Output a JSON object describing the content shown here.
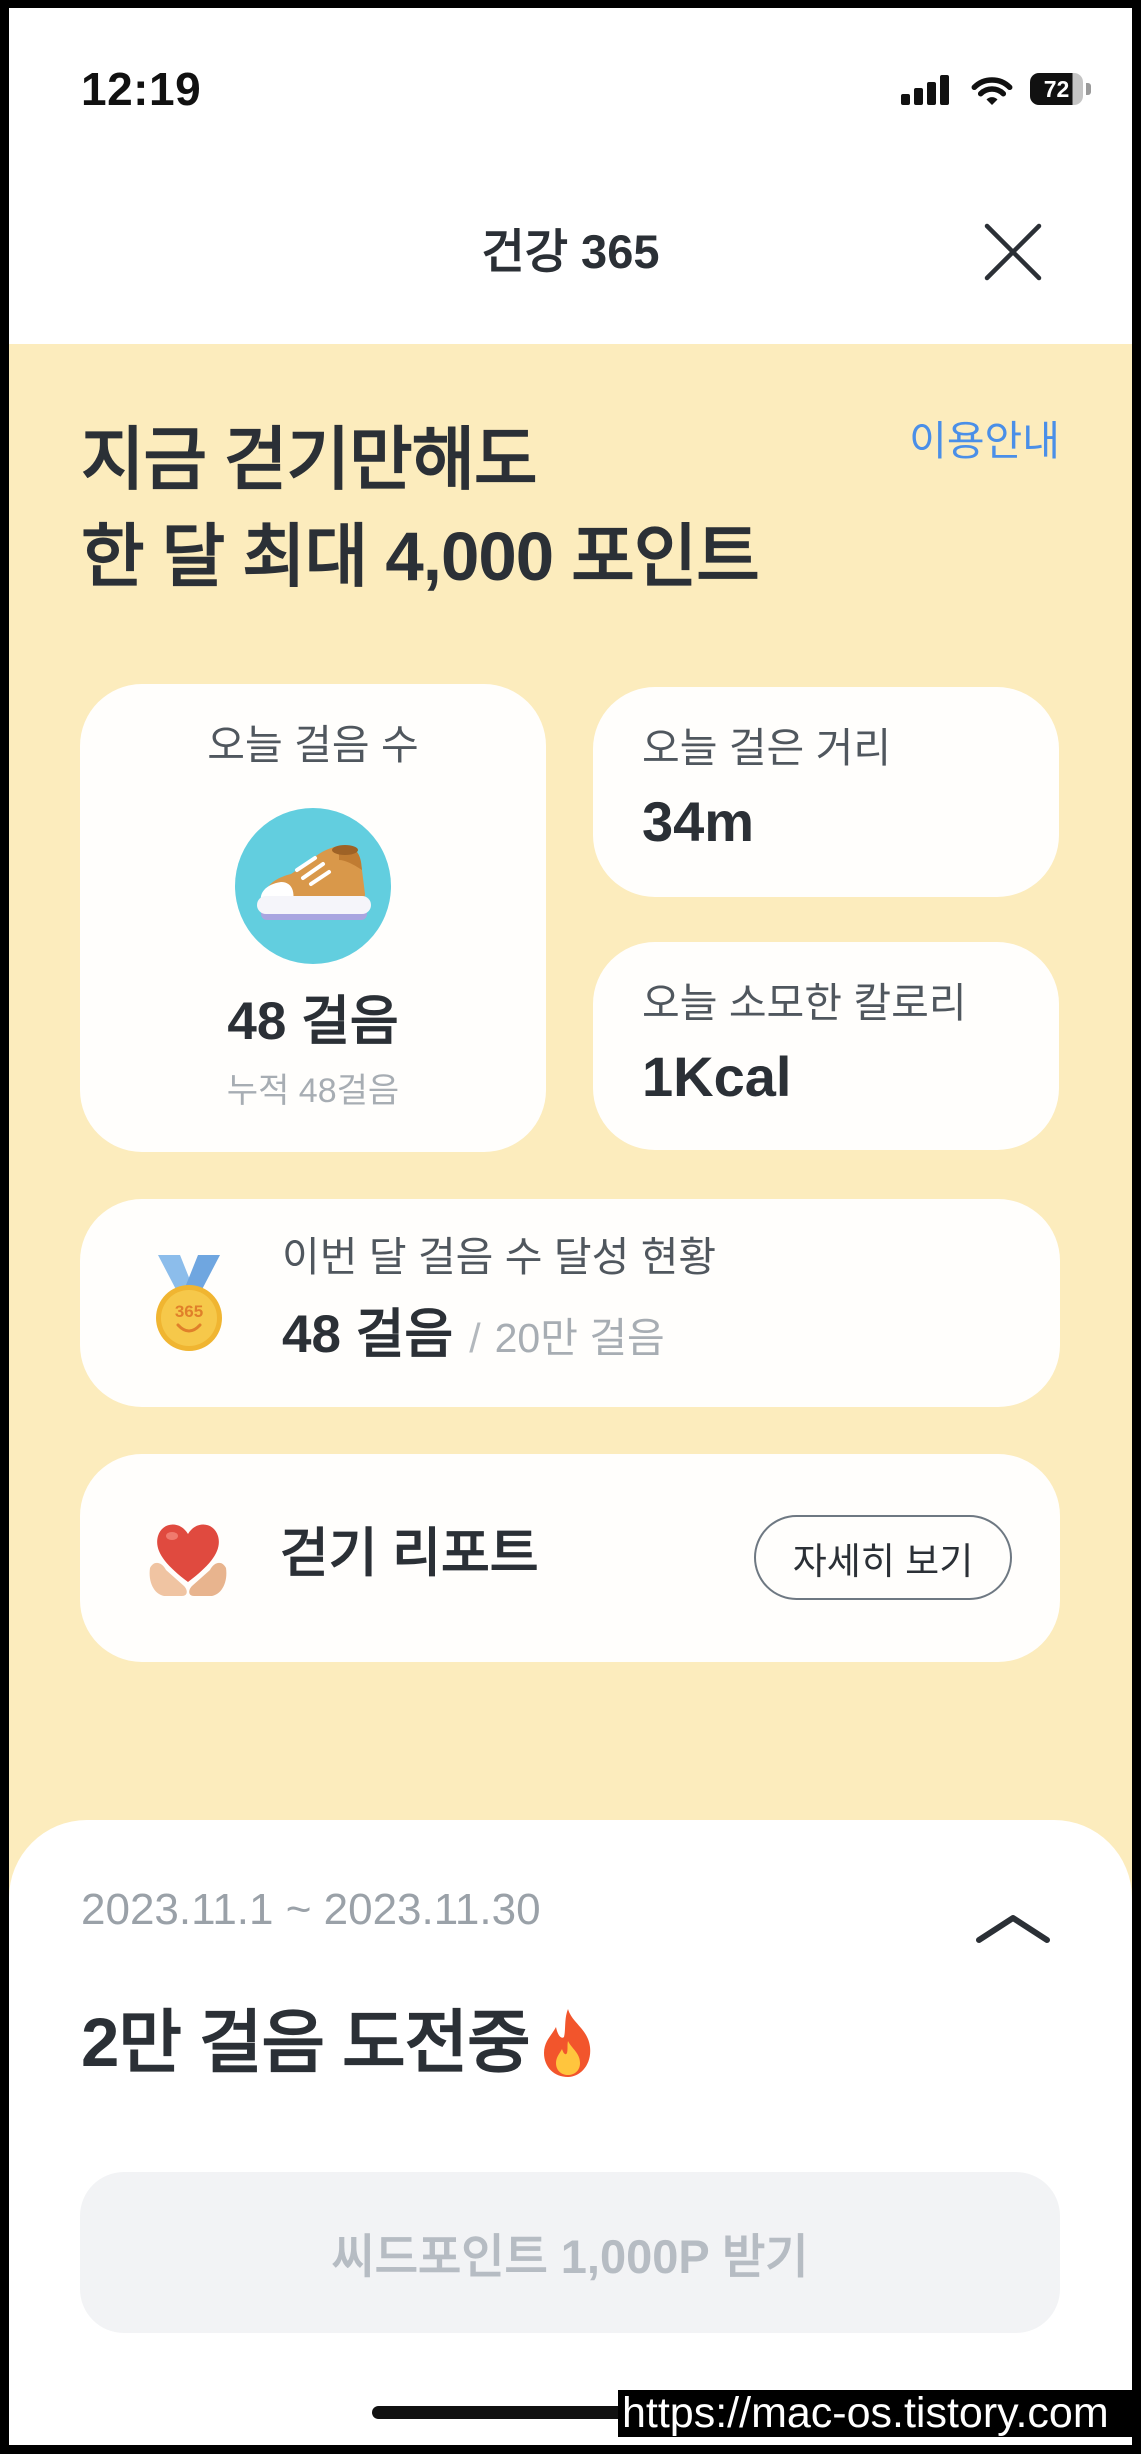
{
  "status_bar": {
    "time": "12:19",
    "battery_level": "72",
    "icons": [
      "cellular-signal-icon",
      "wifi-icon",
      "battery-icon"
    ]
  },
  "header": {
    "title": "건강 365",
    "close_icon": "close-icon"
  },
  "hero": {
    "headline_line1": "지금 걷기만해도",
    "headline_line2": "한 달 최대 4,000 포인트",
    "guide_link": "이용안내"
  },
  "stats": {
    "steps": {
      "label": "오늘 걸음 수",
      "icon": "sneaker-icon",
      "value": "48 걸음",
      "cumulative": "누적 48걸음"
    },
    "distance": {
      "label": "오늘 걸은 거리",
      "value": "34m"
    },
    "calories": {
      "label": "오늘 소모한 칼로리",
      "value": "1Kcal"
    }
  },
  "monthly_progress": {
    "icon": "medal-icon",
    "medal_text": "365",
    "label": "이번 달 걸음 수 달성 현황",
    "current": "48 걸음",
    "separator": "/",
    "goal": "20만 걸음"
  },
  "walking_report": {
    "icon": "heart-in-hands-icon",
    "title": "걷기 리포트",
    "button_label": "자세히 보기"
  },
  "challenge": {
    "period": "2023.11.1 ~ 2023.11.30",
    "toggle_icon": "chevron-up-icon",
    "title": "2만 걸음 도전중",
    "title_icon": "fire-icon",
    "reward_button_label": "씨드포인트 1,000P 받기",
    "reward_button_enabled": false
  },
  "watermark": "https://mac-os.tistory.com",
  "colors": {
    "background_yellow": "#FCECBD",
    "card": "#FFFEFC",
    "text_primary": "#2B3036",
    "text_secondary": "#50575E",
    "text_muted": "#A7ADB3",
    "link_blue": "#4A8FE8",
    "disabled_bg": "#F2F3F5",
    "disabled_text": "#B6BCC3",
    "icon_teal": "#62CEDF"
  }
}
